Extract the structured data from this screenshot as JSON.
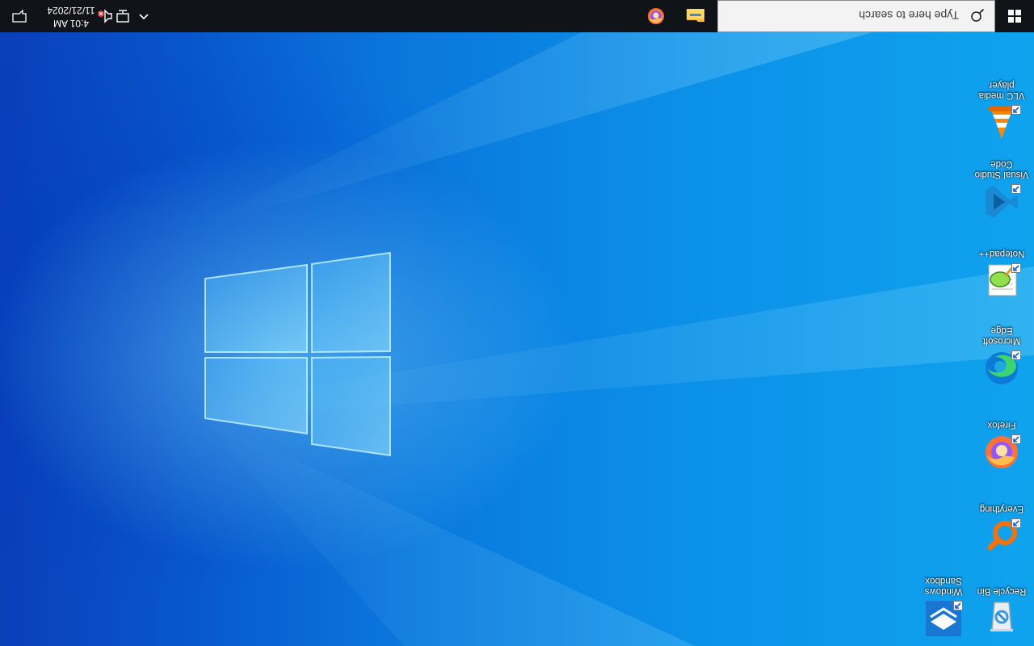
{
  "desktop": {
    "icons": [
      {
        "label": "Recycle Bin",
        "icon": "recycle-bin-icon"
      },
      {
        "label": "Windows Sandbox",
        "icon": "windows-sandbox-icon"
      },
      {
        "label": "Everything",
        "icon": "everything-search-icon"
      },
      {
        "label": "Firefox",
        "icon": "firefox-icon"
      },
      {
        "label": "Microsoft Edge",
        "icon": "edge-icon"
      },
      {
        "label": "Notepad++",
        "icon": "notepadpp-icon"
      },
      {
        "label": "Visual Studio Code",
        "icon": "vscode-icon"
      },
      {
        "label": "VLC media player",
        "icon": "vlc-icon"
      }
    ],
    "shortcut_overlay_icon": "shortcut-arrow-icon",
    "wallpaper": "windows-logo-light-beams"
  },
  "taskbar": {
    "start_icon": "windows-start-icon",
    "search": {
      "placeholder": "Type here to search",
      "icon": "search-icon"
    },
    "pinned_apps": [
      {
        "name": "File Explorer",
        "icon": "file-explorer-icon"
      },
      {
        "name": "Firefox",
        "icon": "firefox-icon"
      }
    ],
    "tray": {
      "chevron_icon": "show-hidden-icons-chevron",
      "network_icon": "network-icon",
      "volume_icon": "volume-muted-icon",
      "time": "4:01 AM",
      "date": "11/21/2024",
      "notification_icon": "action-center-icon"
    }
  },
  "colors": {
    "taskbar_bg": "#101318",
    "search_bg": "#f3f3f3",
    "desktop_light": "#0fa3ee",
    "desktop_dark": "#0a3fb8"
  },
  "orientation": "rotated-180"
}
